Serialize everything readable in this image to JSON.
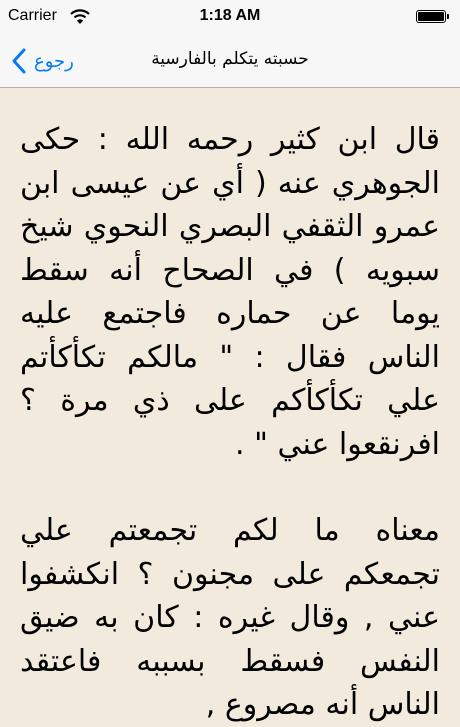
{
  "status_bar": {
    "carrier": "Carrier",
    "time": "1:18 AM",
    "wifi_icon": "wifi-icon",
    "battery_icon": "battery-icon"
  },
  "nav": {
    "back_label": "رجوع",
    "back_icon": "chevron-left-icon",
    "title": "حسبته يتكلم بالفارسية",
    "accent_color": "#007aff"
  },
  "content": {
    "paragraphs": [
      "قال ابن كثير رحمه الله : حكى الجوهري عنه ( أي عن عيسى ابن عمرو الثقفي البصري النحوي شيخ سبويه ) في الصحاح أنه سقط يوما عن حماره فاجتمع عليه الناس فقال : \" مالكم تكأكأتم علي تكأكأكم على ذي مرة ؟ افرنقعوا عني \" .",
      "معناه ما لكم تجمعتم علي تجمعكم على مجنون ؟ انكشفوا عني , وقال غيره : كان به ضيق النفس فسقط بسببه فاعتقد الناس أنه مصروع ,"
    ]
  }
}
